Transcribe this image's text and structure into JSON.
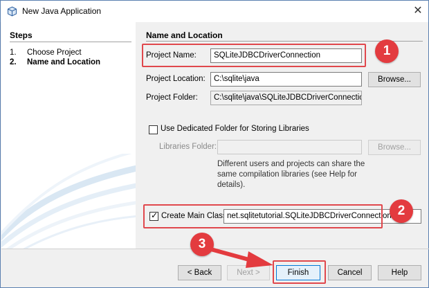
{
  "window": {
    "title": "New Java Application",
    "close_glyph": "✕"
  },
  "steps": {
    "title": "Steps",
    "items": [
      {
        "num": "1.",
        "label": "Choose Project"
      },
      {
        "num": "2.",
        "label": "Name and Location"
      }
    ]
  },
  "section": {
    "title": "Name and Location"
  },
  "form": {
    "project_name": {
      "label": "Project Name:",
      "value": "SQLiteJDBCDriverConnection"
    },
    "project_location": {
      "label": "Project Location:",
      "value": "C:\\sqlite\\java"
    },
    "project_folder": {
      "label": "Project Folder:",
      "value": "C:\\sqlite\\java\\SQLiteJDBCDriverConnection"
    },
    "browse_label": "Browse...",
    "dedicated_folder": {
      "label": "Use Dedicated Folder for Storing Libraries",
      "checked": false
    },
    "libraries_folder": {
      "label": "Libraries Folder:",
      "value": "",
      "browse_label": "Browse..."
    },
    "libraries_desc": "Different users and projects can share the same compilation libraries (see Help for details).",
    "main_class": {
      "label": "Create Main Class",
      "checked": true,
      "value": "net.sqlitetutorial.SQLiteJDBCDriverConnection"
    }
  },
  "buttons": {
    "back": "< Back",
    "next": "Next >",
    "finish": "Finish",
    "cancel": "Cancel",
    "help": "Help"
  },
  "annotations": {
    "badge1": "1",
    "badge2": "2",
    "badge3": "3",
    "color": "#e33b3f"
  }
}
